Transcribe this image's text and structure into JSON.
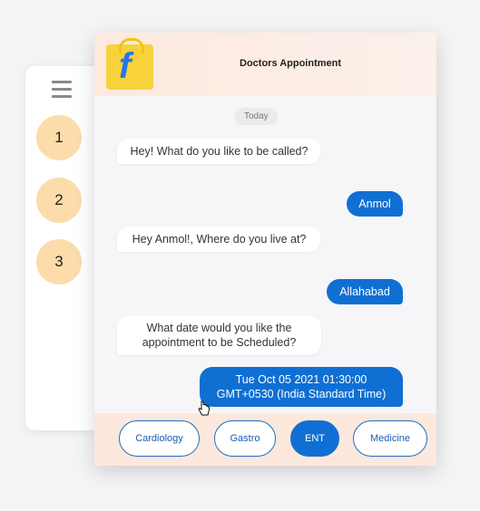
{
  "sidebar": {
    "steps": [
      "1",
      "2",
      "3"
    ]
  },
  "header": {
    "title": "Doctors Appointment",
    "logo": "flipkart-logo"
  },
  "chat": {
    "date_label": "Today",
    "messages": [
      {
        "from": "bot",
        "text": "Hey! What do you like to be called?"
      },
      {
        "from": "user",
        "text": "Anmol"
      },
      {
        "from": "bot",
        "text": "Hey Anmol!, Where do you live at?"
      },
      {
        "from": "user",
        "text": "Allahabad"
      },
      {
        "from": "bot",
        "text": "What date would you like the appointment to be Scheduled?"
      },
      {
        "from": "user",
        "text": "Tue Oct 05 2021 01:30:00 GMT+0530 (India Standard Time)"
      }
    ]
  },
  "options": [
    {
      "label": "Cardiology",
      "active": false
    },
    {
      "label": "Gastro",
      "active": false
    },
    {
      "label": "ENT",
      "active": true
    },
    {
      "label": "Medicine",
      "active": false
    }
  ],
  "colors": {
    "accent": "#0f6fd3",
    "step_circle": "#fbdcaa",
    "header_bg": "#fde9de"
  }
}
